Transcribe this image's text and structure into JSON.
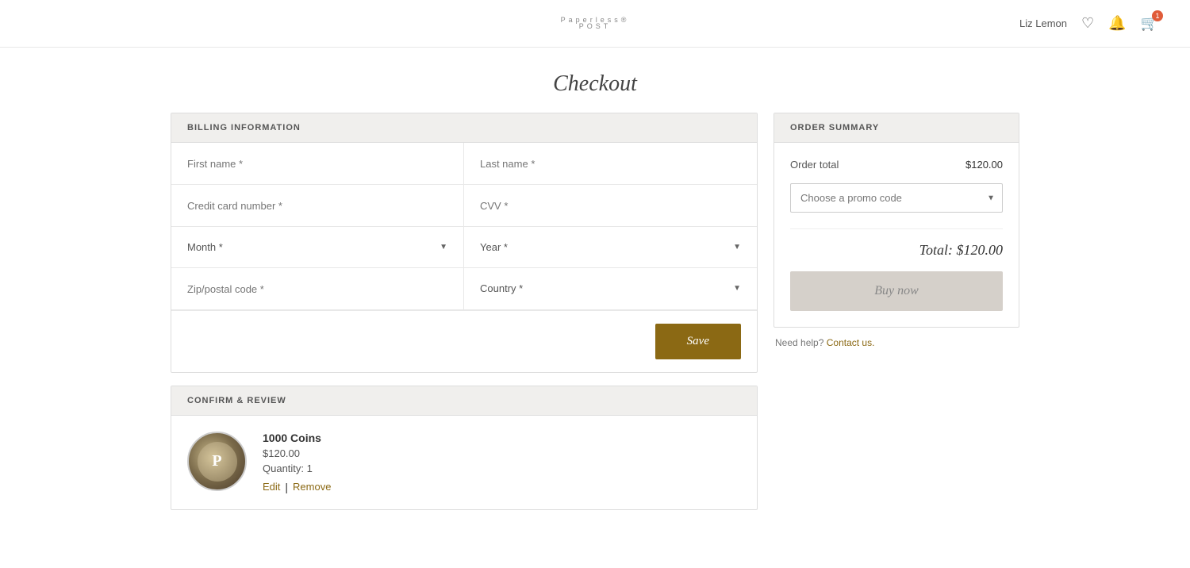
{
  "header": {
    "logo_text": "Paperless®",
    "logo_sub": "POST",
    "username": "Liz Lemon",
    "cart_count": "1"
  },
  "page": {
    "title": "Checkout"
  },
  "billing": {
    "section_label": "BILLING INFORMATION",
    "first_name_placeholder": "First name *",
    "last_name_placeholder": "Last name *",
    "credit_card_placeholder": "Credit card number *",
    "cvv_placeholder": "CVV *",
    "month_placeholder": "Month *",
    "year_placeholder": "Year *",
    "zip_placeholder": "Zip/postal code *",
    "country_placeholder": "Country *",
    "save_label": "Save"
  },
  "confirm": {
    "section_label": "CONFIRM & REVIEW",
    "product_name": "1000 Coins",
    "product_price": "$120.00",
    "product_qty": "Quantity: 1",
    "edit_label": "Edit",
    "remove_label": "Remove",
    "product_icon": "P"
  },
  "order_summary": {
    "section_label": "ORDER SUMMARY",
    "order_total_label": "Order total",
    "order_total_value": "$120.00",
    "promo_placeholder": "Choose a promo code",
    "total_label": "Total: $120.00",
    "buy_now_label": "Buy now",
    "need_help_text": "Need help?",
    "contact_link_text": "Contact us."
  }
}
